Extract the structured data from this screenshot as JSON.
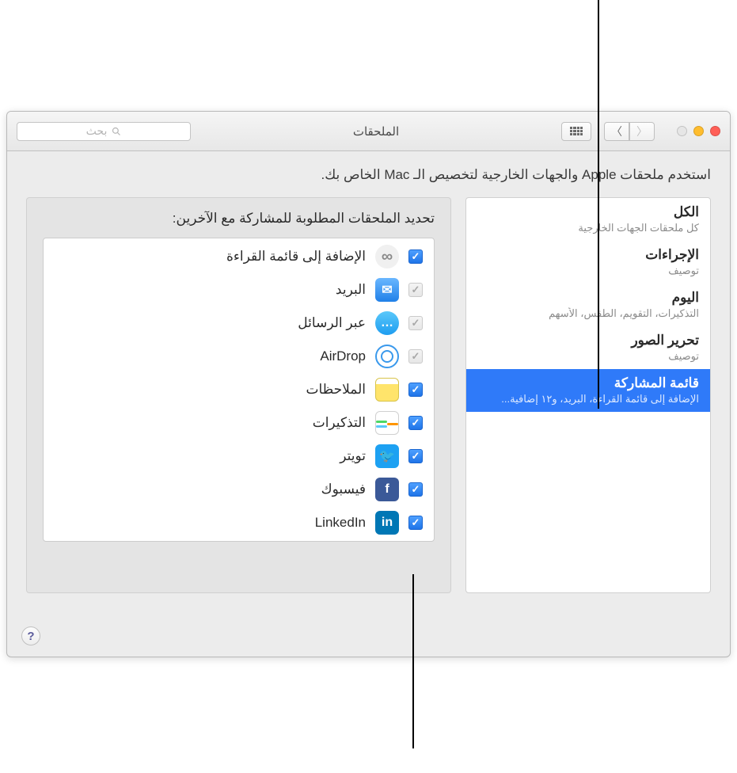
{
  "window": {
    "title": "الملحقات",
    "search_placeholder": "بحث"
  },
  "description": "استخدم ملحقات Apple والجهات الخارجية لتخصيص الـ Mac الخاص بك.",
  "sidebar": {
    "items": [
      {
        "title": "الكل",
        "sub": "كل ملحقات الجهات الخارجية"
      },
      {
        "title": "الإجراءات",
        "sub": "توصيف"
      },
      {
        "title": "اليوم",
        "sub": "التذكيرات، التقويم، الطقس، الأسهم"
      },
      {
        "title": "تحرير الصور",
        "sub": "توصيف"
      },
      {
        "title": "قائمة المشاركة",
        "sub": "الإضافة إلى قائمة القراءة، البريد، و١٢ إضافية..."
      }
    ]
  },
  "detail": {
    "heading": "تحديد الملحقات المطلوبة للمشاركة مع الآخرين:",
    "items": [
      {
        "label": "الإضافة إلى قائمة القراءة",
        "icon": "glasses",
        "glyph": "👓",
        "checked": true,
        "disabled": false
      },
      {
        "label": "البريد",
        "icon": "mail",
        "glyph": "✉",
        "checked": true,
        "disabled": true
      },
      {
        "label": "عبر الرسائل",
        "icon": "messages",
        "glyph": "💬",
        "checked": true,
        "disabled": true
      },
      {
        "label": "AirDrop",
        "icon": "airdrop",
        "glyph": "",
        "checked": true,
        "disabled": true
      },
      {
        "label": "الملاحظات",
        "icon": "notes",
        "glyph": "",
        "checked": true,
        "disabled": false
      },
      {
        "label": "التذكيرات",
        "icon": "reminders",
        "glyph": "",
        "checked": true,
        "disabled": false
      },
      {
        "label": "تويتر",
        "icon": "twitter",
        "glyph": "t",
        "checked": true,
        "disabled": false
      },
      {
        "label": "فيسبوك",
        "icon": "facebook",
        "glyph": "f",
        "checked": true,
        "disabled": false
      },
      {
        "label": "LinkedIn",
        "icon": "linkedin",
        "glyph": "in",
        "checked": true,
        "disabled": false
      }
    ]
  }
}
